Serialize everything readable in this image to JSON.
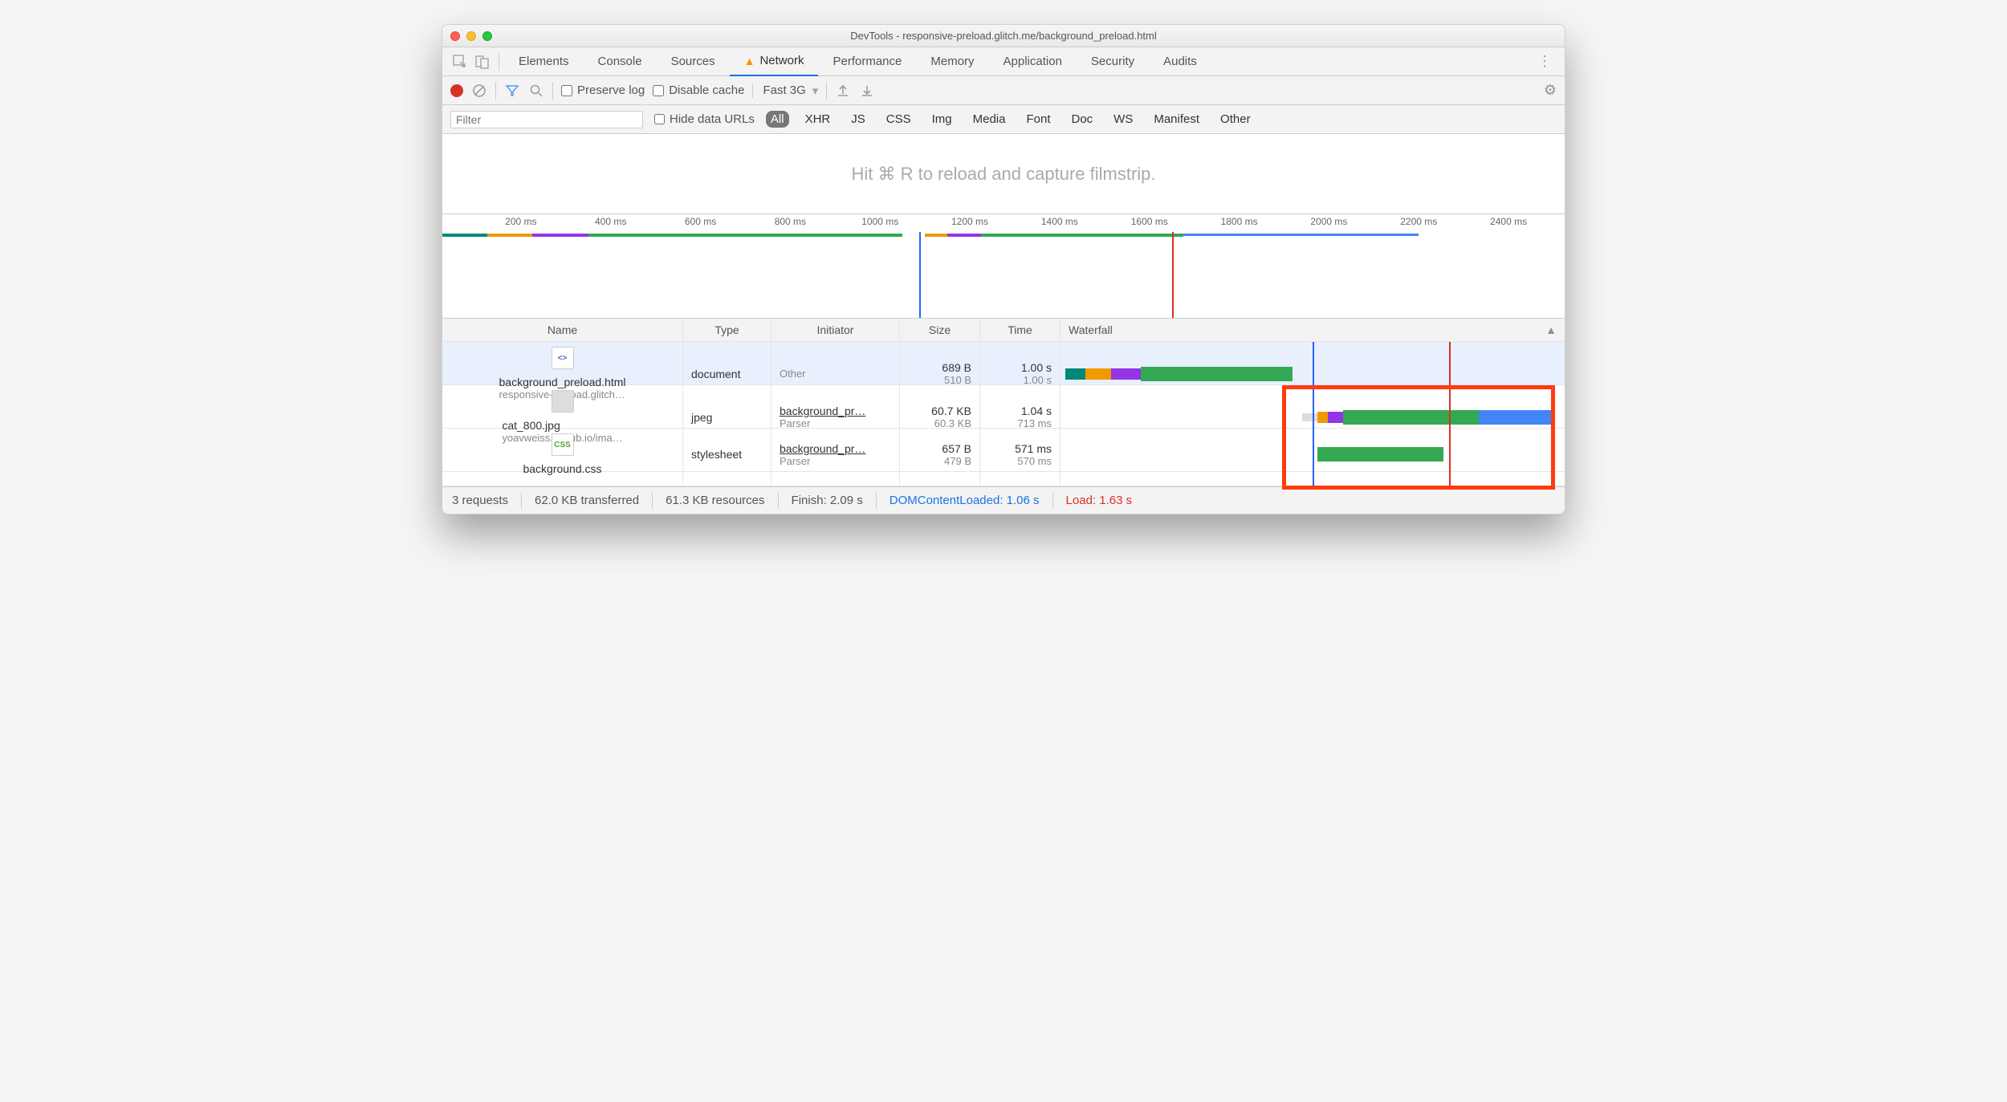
{
  "title": "DevTools - responsive-preload.glitch.me/background_preload.html",
  "tabs": [
    "Elements",
    "Console",
    "Sources",
    "Network",
    "Performance",
    "Memory",
    "Application",
    "Security",
    "Audits"
  ],
  "active_tab": "Network",
  "toolbar": {
    "preserve_log": "Preserve log",
    "disable_cache": "Disable cache",
    "throttle": "Fast 3G"
  },
  "filterbar": {
    "filter_placeholder": "Filter",
    "hide_data_urls": "Hide data URLs",
    "types": [
      "All",
      "XHR",
      "JS",
      "CSS",
      "Img",
      "Media",
      "Font",
      "Doc",
      "WS",
      "Manifest",
      "Other"
    ],
    "active_type": "All"
  },
  "filmstrip_hint": "Hit ⌘ R to reload and capture filmstrip.",
  "overview": {
    "ticks": [
      "200 ms",
      "400 ms",
      "600 ms",
      "800 ms",
      "1000 ms",
      "1200 ms",
      "1400 ms",
      "1600 ms",
      "1800 ms",
      "2000 ms",
      "2200 ms",
      "2400 ms"
    ]
  },
  "columns": [
    "Name",
    "Type",
    "Initiator",
    "Size",
    "Time",
    "Waterfall"
  ],
  "rows": [
    {
      "name": "background_preload.html",
      "sub": "responsive-preload.glitch…",
      "type": "document",
      "initiator": "Other",
      "initiator_sub": "",
      "size": "689 B",
      "size_sub": "510 B",
      "time": "1.00 s",
      "time_sub": "1.00 s",
      "icon": "html"
    },
    {
      "name": "cat_800.jpg",
      "sub": "yoavweiss.github.io/ima…",
      "type": "jpeg",
      "initiator": "background_pr…",
      "initiator_sub": "Parser",
      "size": "60.7 KB",
      "size_sub": "60.3 KB",
      "time": "1.04 s",
      "time_sub": "713 ms",
      "icon": "img"
    },
    {
      "name": "background.css",
      "sub": "",
      "type": "stylesheet",
      "initiator": "background_pr…",
      "initiator_sub": "Parser",
      "size": "657 B",
      "size_sub": "479 B",
      "time": "571 ms",
      "time_sub": "570 ms",
      "icon": "css"
    }
  ],
  "status": {
    "requests": "3 requests",
    "transferred": "62.0 KB transferred",
    "resources": "61.3 KB resources",
    "finish": "Finish: 2.09 s",
    "dcl": "DOMContentLoaded: 1.06 s",
    "load": "Load: 1.63 s"
  }
}
